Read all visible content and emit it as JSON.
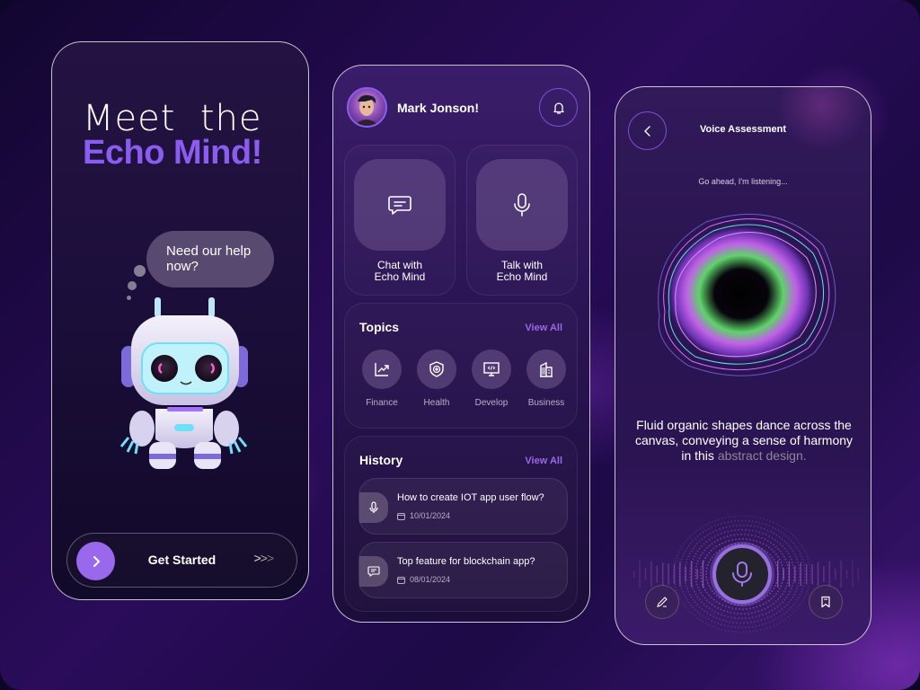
{
  "onboarding": {
    "headline_line1": "Meet  the",
    "headline_line2": "Echo Mind!",
    "speech_bubble": "Need our help now?",
    "cta_label": "Get Started",
    "cta_arrows": [
      ">",
      ">",
      ">"
    ]
  },
  "home": {
    "user_name": "Mark Jonson!",
    "actions": [
      {
        "label_line1": "Chat with",
        "label_line2": "Echo Mind",
        "icon": "chat-icon"
      },
      {
        "label_line1": "Talk with",
        "label_line2": "Echo Mind",
        "icon": "microphone-icon"
      }
    ],
    "topics": {
      "title": "Topics",
      "view_all": "View All",
      "items": [
        {
          "label": "Finance",
          "icon": "chart-trend-icon"
        },
        {
          "label": "Health",
          "icon": "shield-plus-icon"
        },
        {
          "label": "Develop",
          "icon": "monitor-code-icon"
        },
        {
          "label": "Business",
          "icon": "building-icon"
        }
      ]
    },
    "history": {
      "title": "History",
      "view_all": "View All",
      "items": [
        {
          "title": "How to create IOT app user flow?",
          "date": "10/01/2024",
          "icon": "microphone-icon"
        },
        {
          "title": "Top feature for blockchain app?",
          "date": "08/01/2024",
          "icon": "chat-icon"
        }
      ]
    }
  },
  "voice": {
    "title": "Voice Assessment",
    "status": "Go ahead, I'm listening...",
    "caption_main": "Fluid organic shapes dance across the canvas, conveying a sense of harmony in this ",
    "caption_muted": "abstract design.",
    "colors": {
      "accent": "#9670e0",
      "muted_text": "#8e8696"
    }
  },
  "theme": {
    "accent": "#8b5cf0",
    "button": "#9a68ec"
  }
}
